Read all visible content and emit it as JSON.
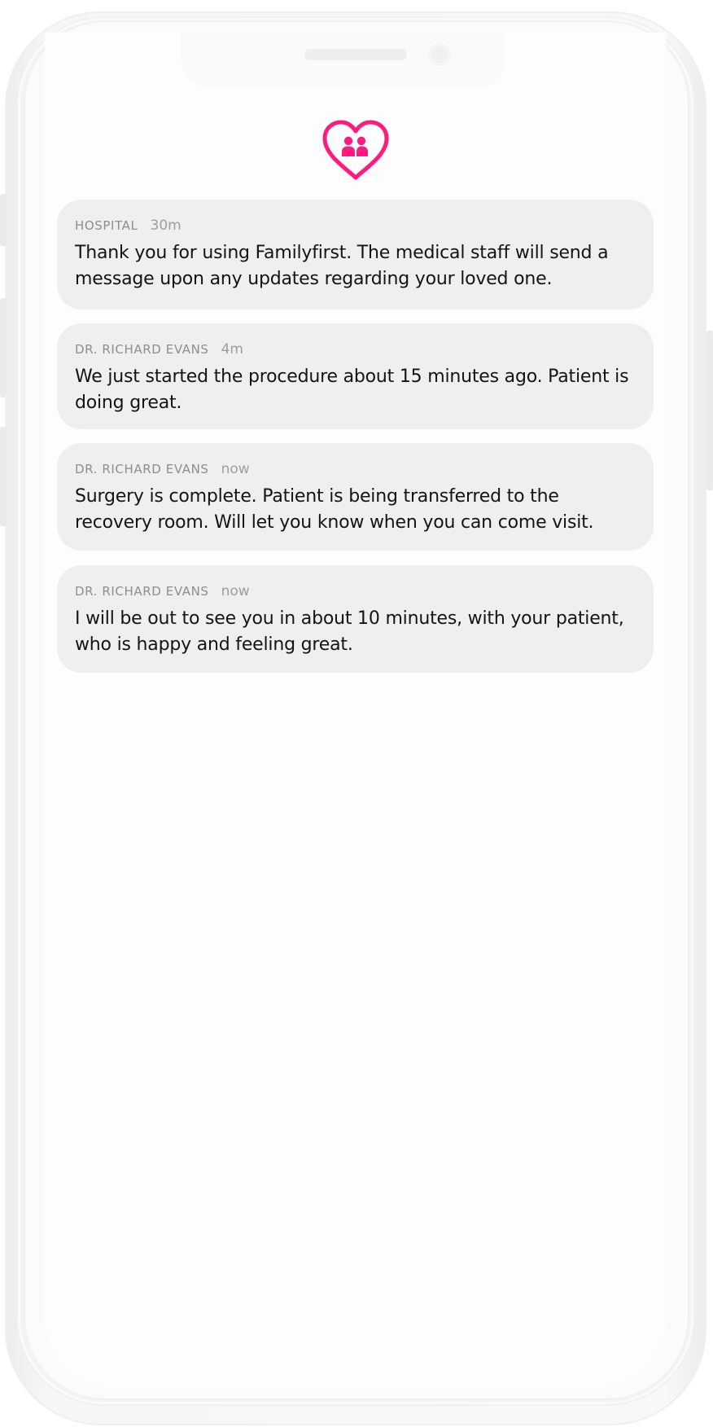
{
  "app": {
    "name": "Familyfirst",
    "brand_color": "#ff1b7d",
    "logo_icon": "heart-family-icon"
  },
  "notifications": [
    {
      "sender": "HOSPITAL",
      "time": "30m",
      "message": "Thank you for using Familyfirst. The medical staff will send a message upon any updates regarding your loved one."
    },
    {
      "sender": "DR. RICHARD EVANS",
      "time": "4m",
      "message": "We just started the procedure about 15 minutes ago. Patient is doing great."
    },
    {
      "sender": "DR. RICHARD EVANS",
      "time": "now",
      "message": "Surgery is complete. Patient is being transferred to the recovery room. Will let you know when you can come visit."
    },
    {
      "sender": "DR. RICHARD EVANS",
      "time": "now",
      "message": "I will be out to see you in about 10 minutes, with your patient, who is happy and feeling great."
    }
  ]
}
